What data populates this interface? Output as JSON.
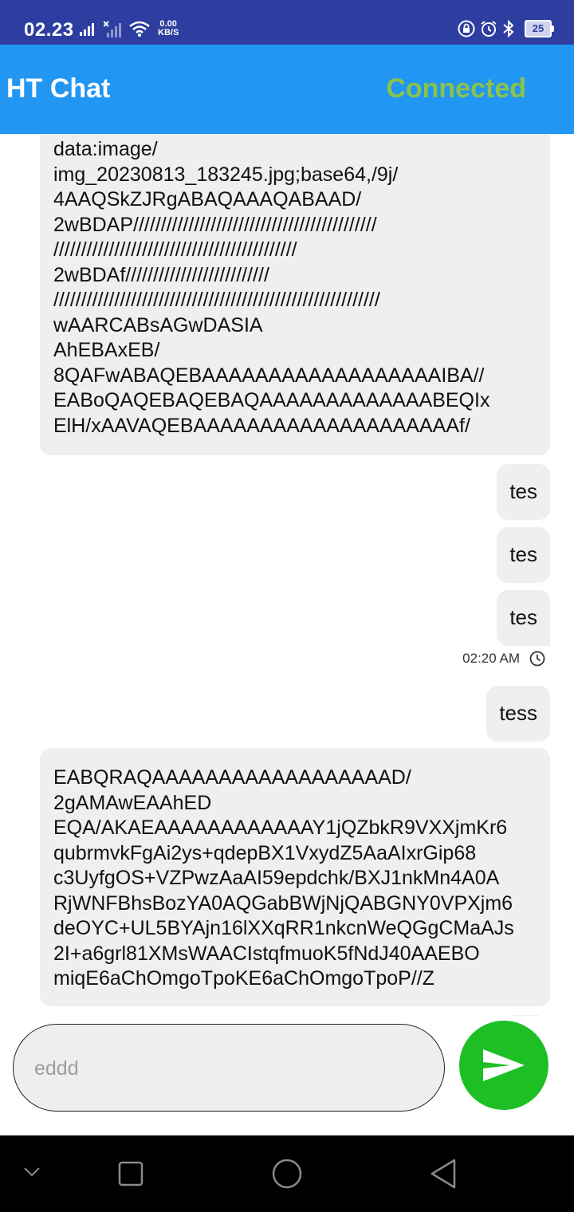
{
  "status_bar": {
    "time": "02.23",
    "net_speed_value": "0.00",
    "net_speed_unit": "KB/S",
    "battery": "25",
    "icons": [
      "signal-icon",
      "signal-off-icon",
      "wifi-icon",
      "lock-icon",
      "alarm-icon",
      "bluetooth-icon",
      "battery-icon"
    ]
  },
  "app_bar": {
    "title": "HT Chat",
    "status": "Connected",
    "status_color": "#8bc34a",
    "background": "#2196f3"
  },
  "messages": [
    {
      "side": "received",
      "lines": [
        "data:image/",
        "img_20230813_183245.jpg;base64,/9j/",
        "4AAQSkZJRgABAQAAAQABAAD/",
        "2wBDAP////////////////////////////////////////////",
        "////////////////////////////////////////////",
        "2wBDAf//////////////////////////",
        "///////////////////////////////////////////////////////////",
        "wAARCABsAGwDASIA",
        "AhEBAxEB/",
        "8QAFwABAQEBAAAAAAAAAAAAAAAAAAIBA//",
        "EABoQAQEBAQEBAQAAAAAAAAAAAAABEQIx",
        "ElH/xAAVAQEBAAAAAAAAAAAAAAAAAAAAf/"
      ]
    },
    {
      "side": "sent",
      "text": "tes"
    },
    {
      "side": "sent",
      "text": "tes"
    },
    {
      "side": "sent",
      "text": "tes"
    },
    {
      "side": "sent",
      "text": "tess"
    },
    {
      "side": "received",
      "lines": [
        "EABQRAQAAAAAAAAAAAAAAAAAAD/",
        "2gAMAwEAAhED",
        "EQA/AKAEAAAAAAAAAAAAY1jQZbkR9VXXjmKr6",
        "qubrmvkFgAi2ys+qdepBX1VxydZ5AaAIxrGip68",
        "c3UyfgOS+VZPwzAaAI59epdchk/BXJ1nkMn4A0A",
        "RjWNFBhsBozYA0AQGabBWjNjQABGNY0VPXjm6",
        "deOYC+UL5BYAjn16lXXqRR1nkcnWeQGgCMaAJs",
        "2I+a6grl81XMsWAACIstqfmuoK5fNdJ40AAEBO",
        "miqE6aChOmgoTpoKE6aChOmgoTpoP//Z"
      ]
    }
  ],
  "timestamp": "02:20 AM",
  "input": {
    "value": "",
    "placeholder": "eddd"
  },
  "colors": {
    "status_bar": "#2d3ea0",
    "send_button": "#1dbf25",
    "bubble": "#efefef"
  }
}
